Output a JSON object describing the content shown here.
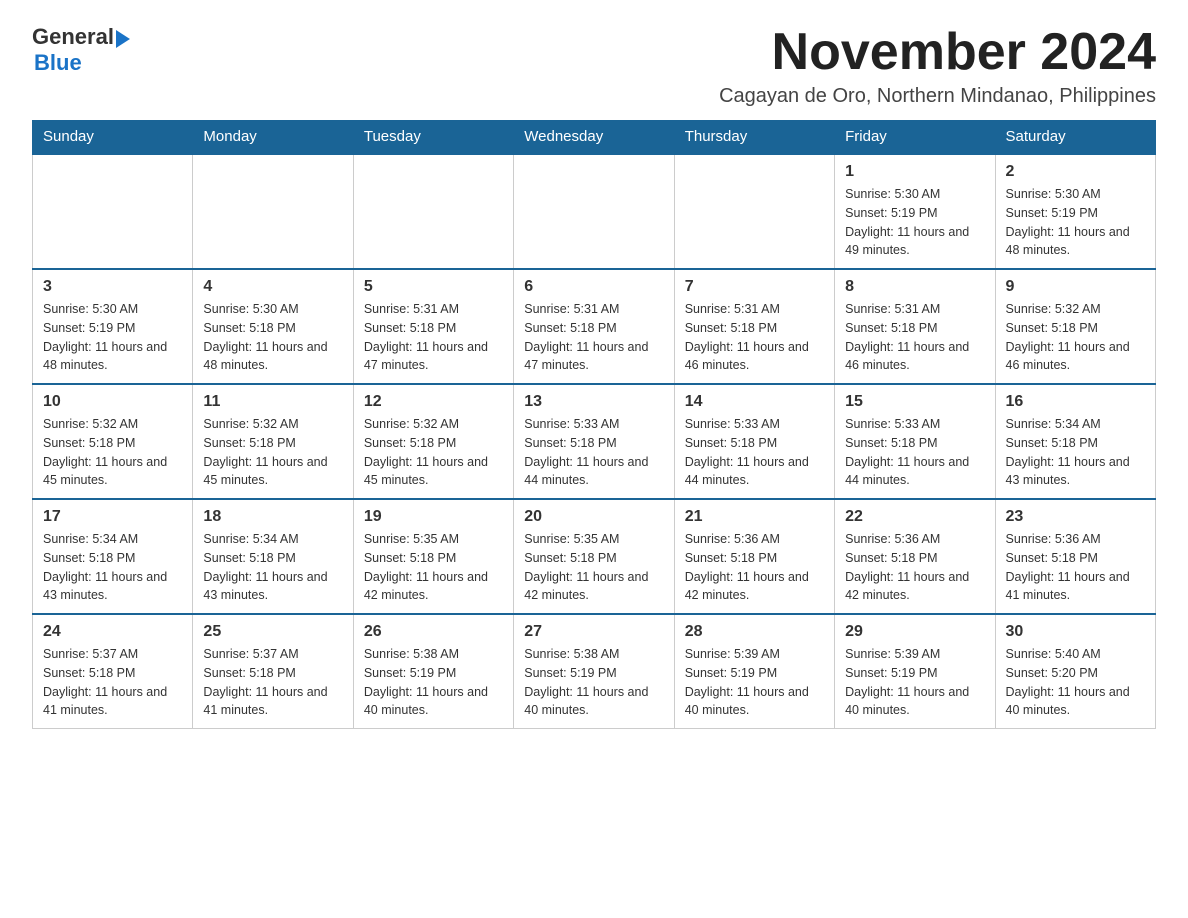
{
  "logo": {
    "general": "General",
    "arrow": "▶",
    "blue": "Blue"
  },
  "title": "November 2024",
  "subtitle": "Cagayan de Oro, Northern Mindanao, Philippines",
  "days_of_week": [
    "Sunday",
    "Monday",
    "Tuesday",
    "Wednesday",
    "Thursday",
    "Friday",
    "Saturday"
  ],
  "weeks": [
    [
      {
        "day": "",
        "info": ""
      },
      {
        "day": "",
        "info": ""
      },
      {
        "day": "",
        "info": ""
      },
      {
        "day": "",
        "info": ""
      },
      {
        "day": "",
        "info": ""
      },
      {
        "day": "1",
        "info": "Sunrise: 5:30 AM\nSunset: 5:19 PM\nDaylight: 11 hours and 49 minutes."
      },
      {
        "day": "2",
        "info": "Sunrise: 5:30 AM\nSunset: 5:19 PM\nDaylight: 11 hours and 48 minutes."
      }
    ],
    [
      {
        "day": "3",
        "info": "Sunrise: 5:30 AM\nSunset: 5:19 PM\nDaylight: 11 hours and 48 minutes."
      },
      {
        "day": "4",
        "info": "Sunrise: 5:30 AM\nSunset: 5:18 PM\nDaylight: 11 hours and 48 minutes."
      },
      {
        "day": "5",
        "info": "Sunrise: 5:31 AM\nSunset: 5:18 PM\nDaylight: 11 hours and 47 minutes."
      },
      {
        "day": "6",
        "info": "Sunrise: 5:31 AM\nSunset: 5:18 PM\nDaylight: 11 hours and 47 minutes."
      },
      {
        "day": "7",
        "info": "Sunrise: 5:31 AM\nSunset: 5:18 PM\nDaylight: 11 hours and 46 minutes."
      },
      {
        "day": "8",
        "info": "Sunrise: 5:31 AM\nSunset: 5:18 PM\nDaylight: 11 hours and 46 minutes."
      },
      {
        "day": "9",
        "info": "Sunrise: 5:32 AM\nSunset: 5:18 PM\nDaylight: 11 hours and 46 minutes."
      }
    ],
    [
      {
        "day": "10",
        "info": "Sunrise: 5:32 AM\nSunset: 5:18 PM\nDaylight: 11 hours and 45 minutes."
      },
      {
        "day": "11",
        "info": "Sunrise: 5:32 AM\nSunset: 5:18 PM\nDaylight: 11 hours and 45 minutes."
      },
      {
        "day": "12",
        "info": "Sunrise: 5:32 AM\nSunset: 5:18 PM\nDaylight: 11 hours and 45 minutes."
      },
      {
        "day": "13",
        "info": "Sunrise: 5:33 AM\nSunset: 5:18 PM\nDaylight: 11 hours and 44 minutes."
      },
      {
        "day": "14",
        "info": "Sunrise: 5:33 AM\nSunset: 5:18 PM\nDaylight: 11 hours and 44 minutes."
      },
      {
        "day": "15",
        "info": "Sunrise: 5:33 AM\nSunset: 5:18 PM\nDaylight: 11 hours and 44 minutes."
      },
      {
        "day": "16",
        "info": "Sunrise: 5:34 AM\nSunset: 5:18 PM\nDaylight: 11 hours and 43 minutes."
      }
    ],
    [
      {
        "day": "17",
        "info": "Sunrise: 5:34 AM\nSunset: 5:18 PM\nDaylight: 11 hours and 43 minutes."
      },
      {
        "day": "18",
        "info": "Sunrise: 5:34 AM\nSunset: 5:18 PM\nDaylight: 11 hours and 43 minutes."
      },
      {
        "day": "19",
        "info": "Sunrise: 5:35 AM\nSunset: 5:18 PM\nDaylight: 11 hours and 42 minutes."
      },
      {
        "day": "20",
        "info": "Sunrise: 5:35 AM\nSunset: 5:18 PM\nDaylight: 11 hours and 42 minutes."
      },
      {
        "day": "21",
        "info": "Sunrise: 5:36 AM\nSunset: 5:18 PM\nDaylight: 11 hours and 42 minutes."
      },
      {
        "day": "22",
        "info": "Sunrise: 5:36 AM\nSunset: 5:18 PM\nDaylight: 11 hours and 42 minutes."
      },
      {
        "day": "23",
        "info": "Sunrise: 5:36 AM\nSunset: 5:18 PM\nDaylight: 11 hours and 41 minutes."
      }
    ],
    [
      {
        "day": "24",
        "info": "Sunrise: 5:37 AM\nSunset: 5:18 PM\nDaylight: 11 hours and 41 minutes."
      },
      {
        "day": "25",
        "info": "Sunrise: 5:37 AM\nSunset: 5:18 PM\nDaylight: 11 hours and 41 minutes."
      },
      {
        "day": "26",
        "info": "Sunrise: 5:38 AM\nSunset: 5:19 PM\nDaylight: 11 hours and 40 minutes."
      },
      {
        "day": "27",
        "info": "Sunrise: 5:38 AM\nSunset: 5:19 PM\nDaylight: 11 hours and 40 minutes."
      },
      {
        "day": "28",
        "info": "Sunrise: 5:39 AM\nSunset: 5:19 PM\nDaylight: 11 hours and 40 minutes."
      },
      {
        "day": "29",
        "info": "Sunrise: 5:39 AM\nSunset: 5:19 PM\nDaylight: 11 hours and 40 minutes."
      },
      {
        "day": "30",
        "info": "Sunrise: 5:40 AM\nSunset: 5:20 PM\nDaylight: 11 hours and 40 minutes."
      }
    ]
  ]
}
